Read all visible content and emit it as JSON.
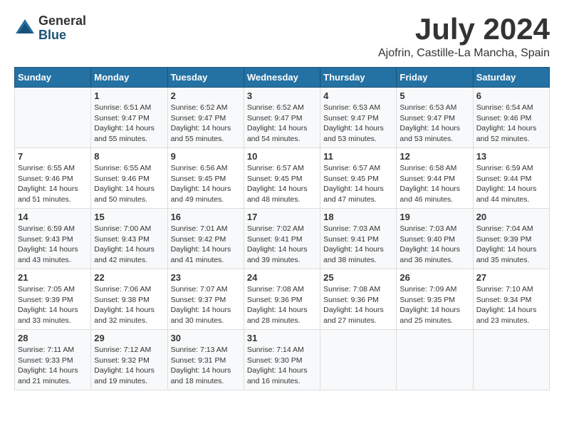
{
  "header": {
    "logo_general": "General",
    "logo_blue": "Blue",
    "month": "July 2024",
    "location": "Ajofrin, Castille-La Mancha, Spain"
  },
  "weekdays": [
    "Sunday",
    "Monday",
    "Tuesday",
    "Wednesday",
    "Thursday",
    "Friday",
    "Saturday"
  ],
  "weeks": [
    [
      {
        "day": "",
        "sunrise": "",
        "sunset": "",
        "daylight": ""
      },
      {
        "day": "1",
        "sunrise": "Sunrise: 6:51 AM",
        "sunset": "Sunset: 9:47 PM",
        "daylight": "Daylight: 14 hours and 55 minutes."
      },
      {
        "day": "2",
        "sunrise": "Sunrise: 6:52 AM",
        "sunset": "Sunset: 9:47 PM",
        "daylight": "Daylight: 14 hours and 55 minutes."
      },
      {
        "day": "3",
        "sunrise": "Sunrise: 6:52 AM",
        "sunset": "Sunset: 9:47 PM",
        "daylight": "Daylight: 14 hours and 54 minutes."
      },
      {
        "day": "4",
        "sunrise": "Sunrise: 6:53 AM",
        "sunset": "Sunset: 9:47 PM",
        "daylight": "Daylight: 14 hours and 53 minutes."
      },
      {
        "day": "5",
        "sunrise": "Sunrise: 6:53 AM",
        "sunset": "Sunset: 9:47 PM",
        "daylight": "Daylight: 14 hours and 53 minutes."
      },
      {
        "day": "6",
        "sunrise": "Sunrise: 6:54 AM",
        "sunset": "Sunset: 9:46 PM",
        "daylight": "Daylight: 14 hours and 52 minutes."
      }
    ],
    [
      {
        "day": "7",
        "sunrise": "Sunrise: 6:55 AM",
        "sunset": "Sunset: 9:46 PM",
        "daylight": "Daylight: 14 hours and 51 minutes."
      },
      {
        "day": "8",
        "sunrise": "Sunrise: 6:55 AM",
        "sunset": "Sunset: 9:46 PM",
        "daylight": "Daylight: 14 hours and 50 minutes."
      },
      {
        "day": "9",
        "sunrise": "Sunrise: 6:56 AM",
        "sunset": "Sunset: 9:45 PM",
        "daylight": "Daylight: 14 hours and 49 minutes."
      },
      {
        "day": "10",
        "sunrise": "Sunrise: 6:57 AM",
        "sunset": "Sunset: 9:45 PM",
        "daylight": "Daylight: 14 hours and 48 minutes."
      },
      {
        "day": "11",
        "sunrise": "Sunrise: 6:57 AM",
        "sunset": "Sunset: 9:45 PM",
        "daylight": "Daylight: 14 hours and 47 minutes."
      },
      {
        "day": "12",
        "sunrise": "Sunrise: 6:58 AM",
        "sunset": "Sunset: 9:44 PM",
        "daylight": "Daylight: 14 hours and 46 minutes."
      },
      {
        "day": "13",
        "sunrise": "Sunrise: 6:59 AM",
        "sunset": "Sunset: 9:44 PM",
        "daylight": "Daylight: 14 hours and 44 minutes."
      }
    ],
    [
      {
        "day": "14",
        "sunrise": "Sunrise: 6:59 AM",
        "sunset": "Sunset: 9:43 PM",
        "daylight": "Daylight: 14 hours and 43 minutes."
      },
      {
        "day": "15",
        "sunrise": "Sunrise: 7:00 AM",
        "sunset": "Sunset: 9:43 PM",
        "daylight": "Daylight: 14 hours and 42 minutes."
      },
      {
        "day": "16",
        "sunrise": "Sunrise: 7:01 AM",
        "sunset": "Sunset: 9:42 PM",
        "daylight": "Daylight: 14 hours and 41 minutes."
      },
      {
        "day": "17",
        "sunrise": "Sunrise: 7:02 AM",
        "sunset": "Sunset: 9:41 PM",
        "daylight": "Daylight: 14 hours and 39 minutes."
      },
      {
        "day": "18",
        "sunrise": "Sunrise: 7:03 AM",
        "sunset": "Sunset: 9:41 PM",
        "daylight": "Daylight: 14 hours and 38 minutes."
      },
      {
        "day": "19",
        "sunrise": "Sunrise: 7:03 AM",
        "sunset": "Sunset: 9:40 PM",
        "daylight": "Daylight: 14 hours and 36 minutes."
      },
      {
        "day": "20",
        "sunrise": "Sunrise: 7:04 AM",
        "sunset": "Sunset: 9:39 PM",
        "daylight": "Daylight: 14 hours and 35 minutes."
      }
    ],
    [
      {
        "day": "21",
        "sunrise": "Sunrise: 7:05 AM",
        "sunset": "Sunset: 9:39 PM",
        "daylight": "Daylight: 14 hours and 33 minutes."
      },
      {
        "day": "22",
        "sunrise": "Sunrise: 7:06 AM",
        "sunset": "Sunset: 9:38 PM",
        "daylight": "Daylight: 14 hours and 32 minutes."
      },
      {
        "day": "23",
        "sunrise": "Sunrise: 7:07 AM",
        "sunset": "Sunset: 9:37 PM",
        "daylight": "Daylight: 14 hours and 30 minutes."
      },
      {
        "day": "24",
        "sunrise": "Sunrise: 7:08 AM",
        "sunset": "Sunset: 9:36 PM",
        "daylight": "Daylight: 14 hours and 28 minutes."
      },
      {
        "day": "25",
        "sunrise": "Sunrise: 7:08 AM",
        "sunset": "Sunset: 9:36 PM",
        "daylight": "Daylight: 14 hours and 27 minutes."
      },
      {
        "day": "26",
        "sunrise": "Sunrise: 7:09 AM",
        "sunset": "Sunset: 9:35 PM",
        "daylight": "Daylight: 14 hours and 25 minutes."
      },
      {
        "day": "27",
        "sunrise": "Sunrise: 7:10 AM",
        "sunset": "Sunset: 9:34 PM",
        "daylight": "Daylight: 14 hours and 23 minutes."
      }
    ],
    [
      {
        "day": "28",
        "sunrise": "Sunrise: 7:11 AM",
        "sunset": "Sunset: 9:33 PM",
        "daylight": "Daylight: 14 hours and 21 minutes."
      },
      {
        "day": "29",
        "sunrise": "Sunrise: 7:12 AM",
        "sunset": "Sunset: 9:32 PM",
        "daylight": "Daylight: 14 hours and 19 minutes."
      },
      {
        "day": "30",
        "sunrise": "Sunrise: 7:13 AM",
        "sunset": "Sunset: 9:31 PM",
        "daylight": "Daylight: 14 hours and 18 minutes."
      },
      {
        "day": "31",
        "sunrise": "Sunrise: 7:14 AM",
        "sunset": "Sunset: 9:30 PM",
        "daylight": "Daylight: 14 hours and 16 minutes."
      },
      {
        "day": "",
        "sunrise": "",
        "sunset": "",
        "daylight": ""
      },
      {
        "day": "",
        "sunrise": "",
        "sunset": "",
        "daylight": ""
      },
      {
        "day": "",
        "sunrise": "",
        "sunset": "",
        "daylight": ""
      }
    ]
  ]
}
